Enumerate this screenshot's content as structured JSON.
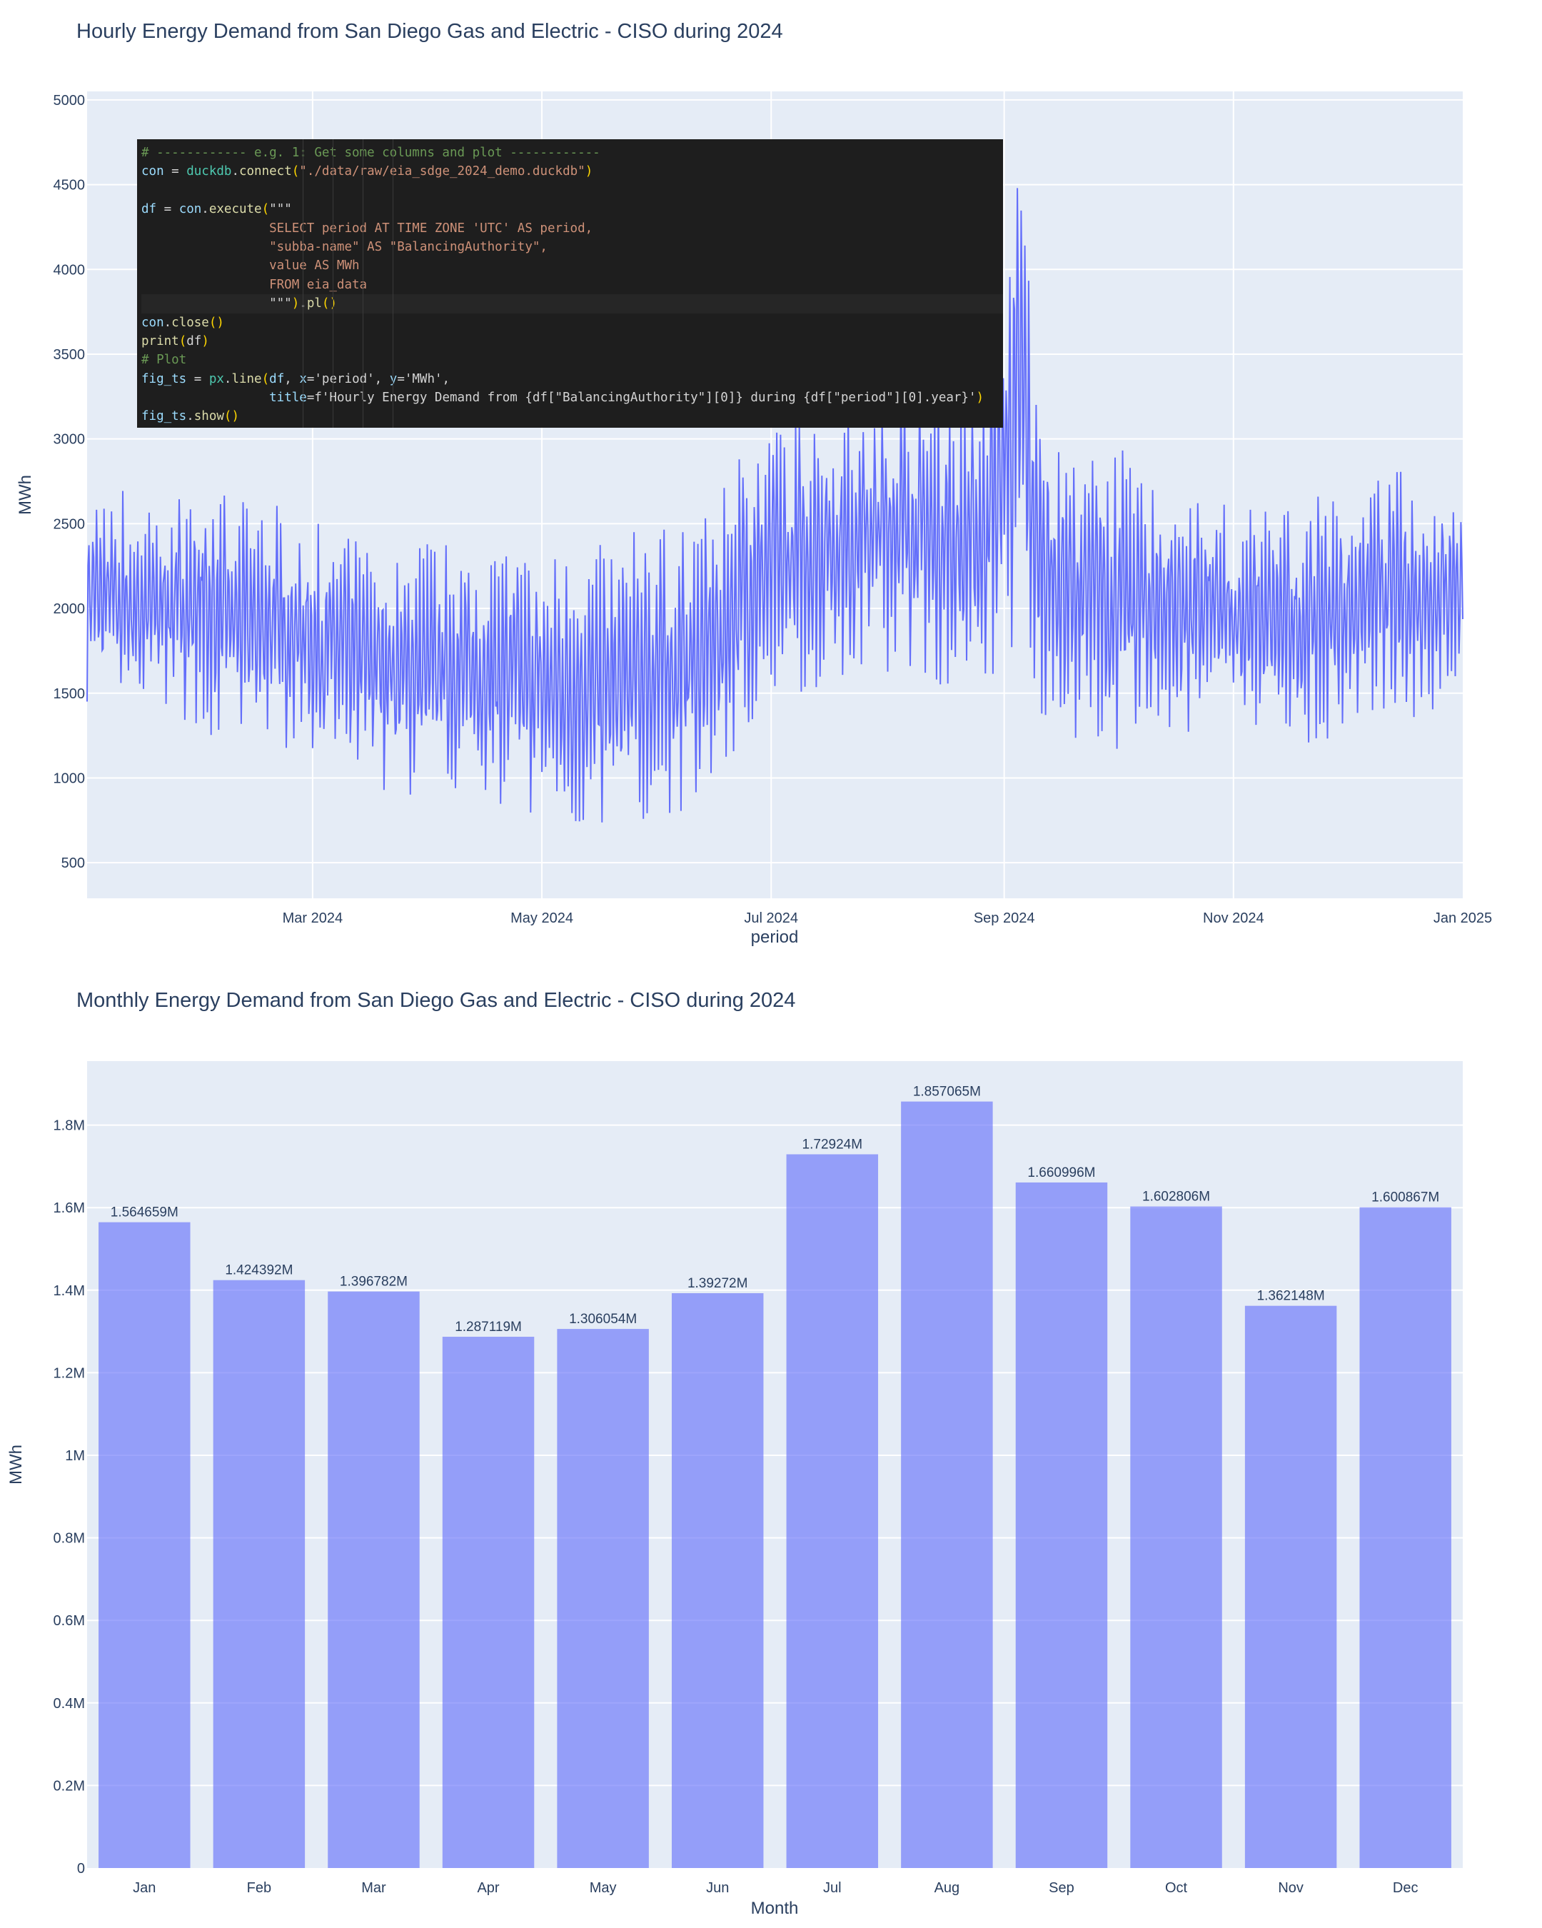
{
  "colors": {
    "plot_bg": "#e5ecf6",
    "grid": "#ffffff",
    "line": "#636efa",
    "bar": "#636efa",
    "text": "#2a3f5f",
    "code_bg": "#1e1e1e"
  },
  "code_overlay": {
    "lines": [
      "# ------------ e.g. 1: Get some columns and plot ------------",
      "con = duckdb.connect(\"./data/raw/eia_sdge_2024_demo.duckdb\")",
      "",
      "df = con.execute(\"\"\"",
      "                 SELECT period AT TIME ZONE 'UTC' AS period,",
      "                 \"subba-name\" AS \"BalancingAuthority\",",
      "                 value AS MWh",
      "                 FROM eia_data",
      "                 \"\"\").pl()",
      "con.close()",
      "print(df)",
      "# Plot",
      "fig_ts = px.line(df, x='period', y='MWh',",
      "                 title=f'Hourly Energy Demand from {df[\"BalancingAuthority\"][0]} during {df[\"period\"][0].year}')",
      "fig_ts.show()"
    ]
  },
  "chart_data": [
    {
      "type": "line",
      "title": "Hourly Energy Demand from San Diego Gas and Electric - CISO during 2024",
      "xlabel": "period",
      "ylabel": "MWh",
      "x_tick_labels": [
        "Mar 2024",
        "May 2024",
        "Jul 2024",
        "Sep 2024",
        "Nov 2024",
        "Jan 2025"
      ],
      "x_tick_dates": [
        "2024-03-01",
        "2024-05-01",
        "2024-07-01",
        "2024-09-01",
        "2024-11-01",
        "2025-01-01"
      ],
      "x_range": [
        "2024-01-01",
        "2025-01-01"
      ],
      "y_ticks": [
        500,
        1000,
        1500,
        2000,
        2500,
        3000,
        3500,
        4000,
        4500,
        5000
      ],
      "y_tick_labels": [
        "500",
        "1000",
        "1500",
        "2000",
        "2500",
        "3000",
        "3500",
        "4000",
        "4500",
        "5000"
      ],
      "ylim": [
        290,
        5050
      ],
      "grid": true,
      "daily_range_MWh": {
        "dates": [
          "2024-01-01",
          "2024-01-08",
          "2024-01-15",
          "2024-01-22",
          "2024-01-29",
          "2024-02-05",
          "2024-02-12",
          "2024-02-19",
          "2024-02-26",
          "2024-03-04",
          "2024-03-11",
          "2024-03-18",
          "2024-03-25",
          "2024-04-01",
          "2024-04-08",
          "2024-04-15",
          "2024-04-22",
          "2024-04-29",
          "2024-05-06",
          "2024-05-13",
          "2024-05-20",
          "2024-05-27",
          "2024-06-03",
          "2024-06-10",
          "2024-06-17",
          "2024-06-24",
          "2024-07-01",
          "2024-07-08",
          "2024-07-15",
          "2024-07-22",
          "2024-07-29",
          "2024-08-05",
          "2024-08-12",
          "2024-08-19",
          "2024-08-26",
          "2024-09-02",
          "2024-09-06",
          "2024-09-09",
          "2024-09-16",
          "2024-09-23",
          "2024-09-30",
          "2024-10-07",
          "2024-10-14",
          "2024-10-21",
          "2024-10-28",
          "2024-11-04",
          "2024-11-11",
          "2024-11-18",
          "2024-11-25",
          "2024-12-02",
          "2024-12-09",
          "2024-12-16",
          "2024-12-23",
          "2024-12-31"
        ],
        "low": [
          1400,
          1250,
          1300,
          1350,
          1200,
          1150,
          1150,
          1100,
          1050,
          1000,
          950,
          900,
          800,
          850,
          850,
          800,
          750,
          700,
          650,
          600,
          600,
          650,
          700,
          750,
          900,
          1150,
          1300,
          1400,
          1450,
          1500,
          1550,
          1550,
          1500,
          1450,
          1450,
          1500,
          1800,
          1350,
          1200,
          1150,
          1050,
          1100,
          1150,
          1150,
          1200,
          1200,
          1150,
          1150,
          1150,
          1200,
          1300,
          1250,
          1300,
          1550
        ],
        "high": [
          2750,
          2800,
          2650,
          2650,
          2800,
          2700,
          2650,
          2700,
          2600,
          2500,
          2450,
          2400,
          2400,
          2450,
          2400,
          2400,
          2450,
          2350,
          2350,
          2350,
          2450,
          2500,
          2500,
          2550,
          2650,
          3050,
          3100,
          3150,
          3200,
          3250,
          3300,
          3400,
          3300,
          3250,
          3300,
          4300,
          4800,
          3350,
          2950,
          2900,
          3050,
          2900,
          2800,
          2750,
          2700,
          2650,
          2650,
          2600,
          2700,
          2750,
          2800,
          2850,
          2800,
          2700
        ]
      }
    },
    {
      "type": "bar",
      "title": "Monthly Energy Demand from San Diego Gas and Electric - CISO during 2024",
      "xlabel": "Month",
      "ylabel": "MWh",
      "categories": [
        "Jan",
        "Feb",
        "Mar",
        "Apr",
        "May",
        "Jun",
        "Jul",
        "Aug",
        "Sep",
        "Oct",
        "Nov",
        "Dec"
      ],
      "values": [
        1564659,
        1424392,
        1396782,
        1287119,
        1306054,
        1392720,
        1729240,
        1857065,
        1660996,
        1602806,
        1362148,
        1600867
      ],
      "data_labels": [
        "1.564659M",
        "1.424392M",
        "1.396782M",
        "1.287119M",
        "1.306054M",
        "1.39272M",
        "1.72924M",
        "1.857065M",
        "1.660996M",
        "1.602806M",
        "1.362148M",
        "1.600867M"
      ],
      "y_ticks": [
        0,
        200000,
        400000,
        600000,
        800000,
        1000000,
        1200000,
        1400000,
        1600000,
        1800000
      ],
      "y_tick_labels": [
        "0",
        "0.2M",
        "0.4M",
        "0.6M",
        "0.8M",
        "1M",
        "1.2M",
        "1.4M",
        "1.6M",
        "1.8M"
      ],
      "ylim": [
        0,
        1955000
      ],
      "grid": true
    }
  ]
}
